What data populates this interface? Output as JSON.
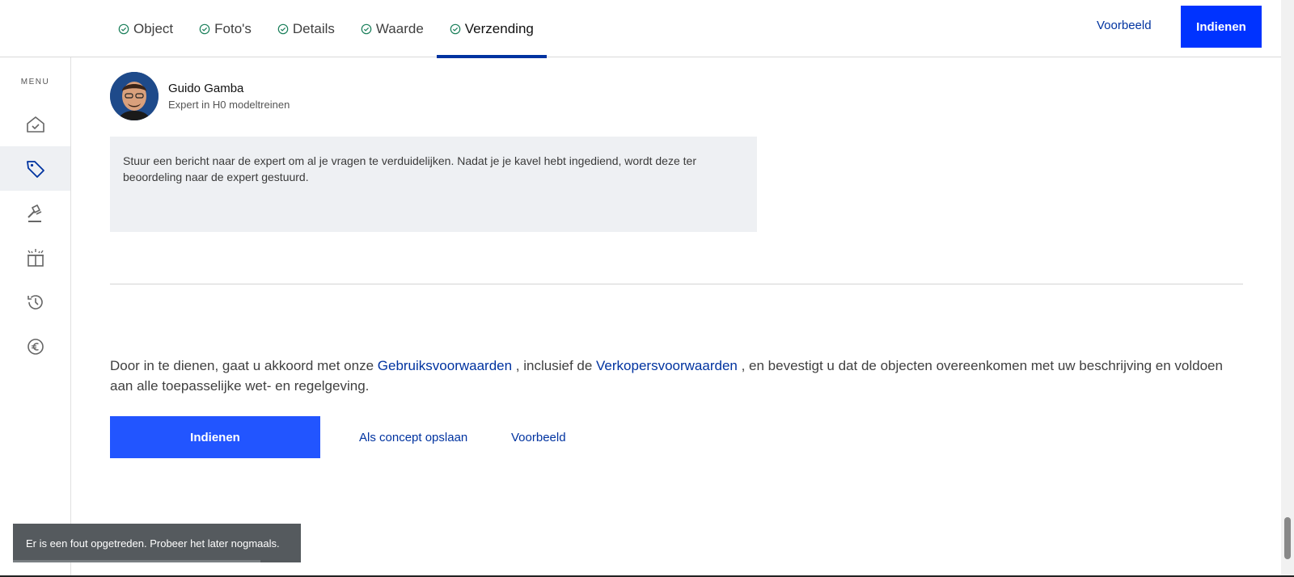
{
  "header": {
    "tabs": [
      {
        "label": "Object"
      },
      {
        "label": "Foto's"
      },
      {
        "label": "Details"
      },
      {
        "label": "Waarde"
      },
      {
        "label": "Verzending"
      }
    ],
    "active_tab": "Verzending",
    "preview_label": "Voorbeeld",
    "submit_label": "Indienen"
  },
  "sidebar": {
    "menu_label": "MENU",
    "items": [
      {
        "icon": "home-check-icon"
      },
      {
        "icon": "tag-icon"
      },
      {
        "icon": "gavel-icon"
      },
      {
        "icon": "gift-icon"
      },
      {
        "icon": "history-icon"
      },
      {
        "icon": "euro-icon"
      }
    ]
  },
  "expert": {
    "name": "Guido Gamba",
    "role": "Expert in H0 modeltreinen"
  },
  "message": {
    "placeholder": "Stuur een bericht naar de expert om al je vragen te verduidelijken. Nadat je je kavel hebt ingediend, wordt deze ter beoordeling naar de expert gestuurd."
  },
  "terms": {
    "prefix": "Door in te dienen, gaat u akkoord met onze ",
    "link1": "Gebruiksvoorwaarden",
    "middle": " , inclusief de ",
    "link2": "Verkopersvoorwaarden",
    "suffix": " , en bevestigt u dat de objecten overeenkomen met uw beschrijving en voldoen aan alle toepasselijke wet- en regelgeving."
  },
  "actions": {
    "submit_label": "Indienen",
    "save_draft_label": "Als concept opslaan",
    "preview_label": "Voorbeeld"
  },
  "toast": {
    "message": "Er is een fout opgetreden. Probeer het later nogmaals.",
    "progress": 0.86
  },
  "colors": {
    "accent": "#0033a0",
    "primary_button": "#2255ff",
    "check": "#1a7f5a"
  }
}
